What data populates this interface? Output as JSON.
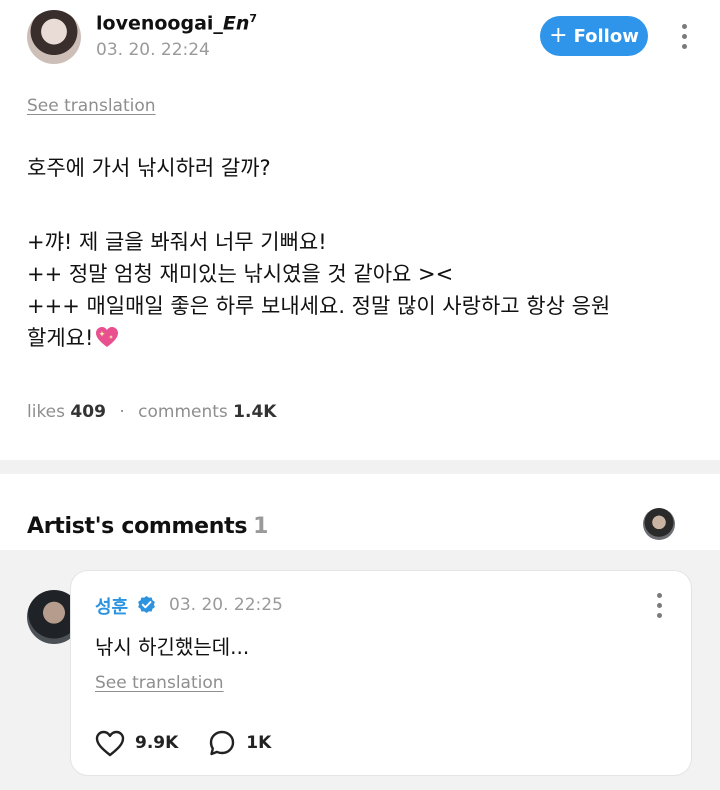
{
  "post": {
    "author": {
      "name": "lovenoogai_",
      "name_suffix": "En",
      "superscript": "7"
    },
    "date": "03. 20. 22:24",
    "follow_label": "Follow",
    "see_translation": "See translation",
    "body": {
      "line1": "호주에 가서 낚시하러 갈까?",
      "line2": "+꺄! 제 글을 봐줘서 너무 기뻐요!",
      "line3": "++ 정말 엄청 재미있는 낚시였을 것 같아요 ><",
      "line4": "+++ 매일매일 좋은 하루 보내세요. 정말 많이 사랑하고 항상 응원",
      "line5": "할게요!",
      "emoji": "sparkling-heart-icon"
    },
    "stats": {
      "likes_label": "likes",
      "likes_value": "409",
      "separator": "·",
      "comments_label": "comments",
      "comments_value": "1.4K"
    }
  },
  "artist_comments": {
    "title": "Artist's comments",
    "count": "1"
  },
  "comment": {
    "name": "성훈",
    "verified_icon": "verified-badge-icon",
    "date": "03. 20. 22:25",
    "text": "낚시 하긴했는데...",
    "see_translation": "See translation",
    "likes": "9.9K",
    "replies": "1K"
  },
  "colors": {
    "accent": "#2e95ea",
    "artist_name": "#2b93e0",
    "muted": "#9a9a9a",
    "heart_emoji": "#e8508f"
  }
}
